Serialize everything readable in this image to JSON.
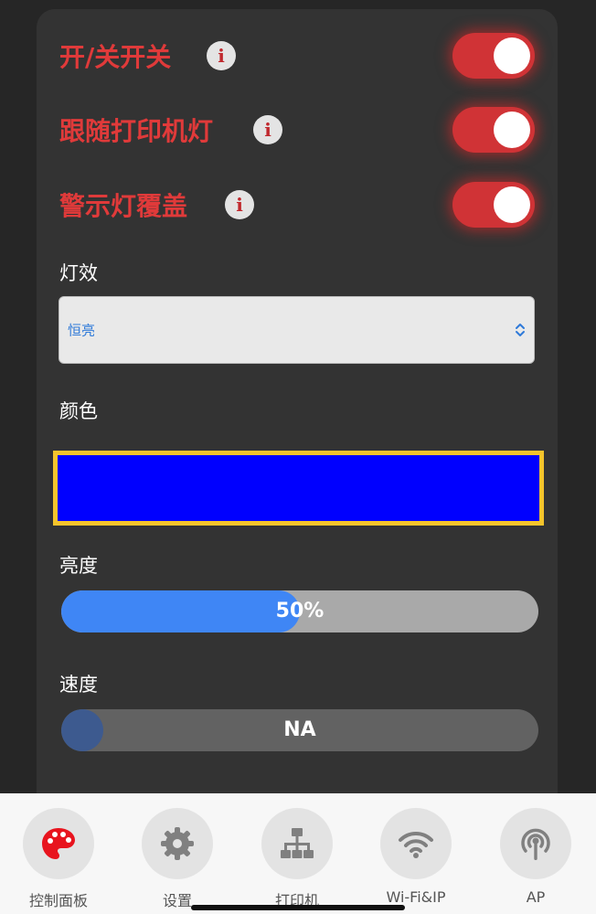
{
  "toggles": [
    {
      "label": "开/关开关",
      "state": "on"
    },
    {
      "label": "跟随打印机灯",
      "state": "on"
    },
    {
      "label": "警示灯覆盖",
      "state": "on"
    }
  ],
  "effect": {
    "label": "灯效",
    "value": "恒亮"
  },
  "color": {
    "label": "颜色",
    "value": "#0000ff"
  },
  "brightness": {
    "label": "亮度",
    "value": 50,
    "display": "50%"
  },
  "speed": {
    "label": "速度",
    "display": "NA"
  },
  "tabs": [
    {
      "label": "控制面板",
      "icon": "palette-icon",
      "active": true
    },
    {
      "label": "设置",
      "icon": "gear-icon"
    },
    {
      "label": "打印机",
      "icon": "network-icon"
    },
    {
      "label": "Wi-Fi&IP",
      "icon": "wifi-icon"
    },
    {
      "label": "AP",
      "icon": "antenna-icon"
    }
  ],
  "colors": {
    "accent": "#e03a3a",
    "switch_on": "#d03336",
    "slider_fill": "#3f86f5",
    "swatch_border": "#f5c42c",
    "active_tab_icon": "#e8141e",
    "inactive_tab_icon": "#808080"
  }
}
